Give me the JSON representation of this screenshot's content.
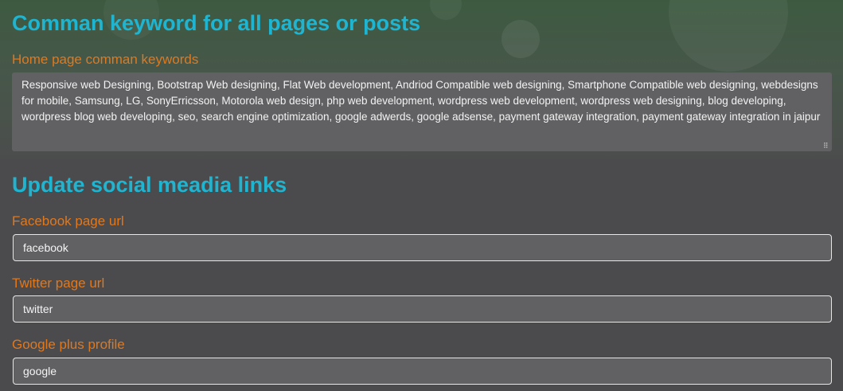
{
  "keywords_section": {
    "title": "Comman keyword for all pages or posts",
    "home_label": "Home page comman keywords",
    "home_value": "Responsive web Designing, Bootstrap Web designing, Flat Web development, Andriod Compatible web designing, Smartphone Compatible web designing, webdesigns for mobile, Samsung, LG, SonyErricsson, Motorola web design, php web development, wordpress web development, wordpress web designing, blog developing, wordpress blog web developing, seo, search engine optimization, google adwerds, google adsense, payment gateway integration, payment gateway integration in jaipur"
  },
  "social_section": {
    "title": "Update social meadia links",
    "facebook": {
      "label": "Facebook page url",
      "value": "facebook"
    },
    "twitter": {
      "label": "Twitter page url",
      "value": "twitter"
    },
    "google": {
      "label": "Google plus profile",
      "value": "google"
    }
  },
  "colors": {
    "heading": "#1fb5d1",
    "label": "#e0781e",
    "field_background": "#616164",
    "page_background": "#4b4b4d"
  }
}
